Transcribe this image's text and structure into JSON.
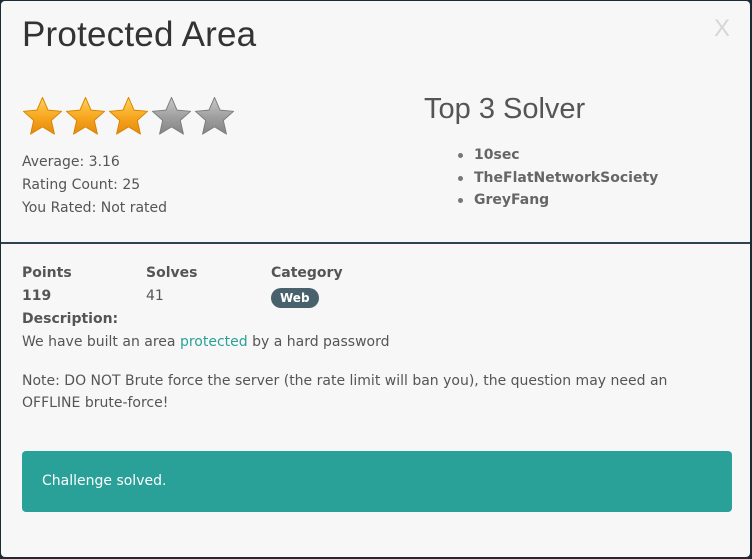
{
  "modal": {
    "title": "Protected Area",
    "close_label": "X"
  },
  "rating": {
    "stars_filled": 3,
    "stars_total": 5,
    "average": "Average: 3.16",
    "count": "Rating Count: 25",
    "you_rated": "You Rated: Not rated"
  },
  "top_solvers": {
    "title": "Top 3 Solver",
    "names": [
      "10sec",
      "TheFlatNetworkSociety",
      "GreyFang"
    ]
  },
  "stats": {
    "points_label": "Points",
    "points_value": "119",
    "solves_label": "Solves",
    "solves_value": "41",
    "category_label": "Category",
    "category_value": "Web"
  },
  "description": {
    "label": "Description:",
    "text_before": "We have built an area ",
    "link_text": "protected",
    "text_after": " by a hard password",
    "note": "Note: DO NOT Brute force the server (the rate limit will ban you), the question may need an OFFLINE brute-force!"
  },
  "alert": {
    "message": "Challenge solved."
  },
  "colors": {
    "accent": "#2aa198",
    "badge": "#49616c",
    "star_filled": "#f5a623",
    "star_empty": "#9a9a9a"
  }
}
